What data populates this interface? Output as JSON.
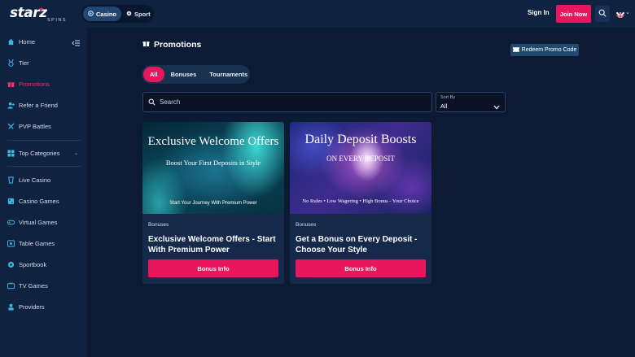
{
  "brand": {
    "name": "starz",
    "sub": "SPINS"
  },
  "header": {
    "modes": [
      {
        "label": "Casino",
        "active": true
      },
      {
        "label": "Sport",
        "active": false
      }
    ],
    "sign_in": "Sign In",
    "join_now": "Join Now",
    "icons": {
      "search": "search-icon",
      "flag": "uk-flag-icon"
    }
  },
  "sidebar": {
    "items": [
      {
        "label": "Home",
        "icon": "home-icon"
      },
      {
        "label": "Tier",
        "icon": "medal-icon"
      },
      {
        "label": "Promotions",
        "icon": "gift-icon",
        "active": true
      },
      {
        "label": "Refer a Friend",
        "icon": "user-plus-icon"
      },
      {
        "label": "PVP Battles",
        "icon": "swords-icon"
      },
      {
        "label": "Top Categories",
        "icon": "grid-icon"
      },
      {
        "label": "Live Casino",
        "icon": "chip-icon"
      },
      {
        "label": "Casino Games",
        "icon": "dice-icon"
      },
      {
        "label": "Virtual Games",
        "icon": "gamepad-icon"
      },
      {
        "label": "Table Games",
        "icon": "table-icon"
      },
      {
        "label": "Sportbook",
        "icon": "ball-icon"
      },
      {
        "label": "TV Games",
        "icon": "tv-icon"
      },
      {
        "label": "Providers",
        "icon": "providers-icon"
      }
    ]
  },
  "main": {
    "title": "Promotions",
    "redeem_label": "Redeem Promo Code",
    "tabs": [
      {
        "label": "All",
        "active": true
      },
      {
        "label": "Bonuses",
        "active": false
      },
      {
        "label": "Tournaments",
        "active": false
      }
    ],
    "search_placeholder": "Search",
    "sort": {
      "label": "Sort By",
      "value": "All"
    },
    "cards": [
      {
        "image_title": "Exclusive Welcome Offers",
        "image_subtitle": "Boost Your First Deposits in Style",
        "image_footer": "Start Your Journey With Premium Power",
        "badge": "Bonuses",
        "heading": "Exclusive Welcome Offers - Start With Premium Power",
        "button": "Bonus Info"
      },
      {
        "image_title": "Daily Deposit Boosts",
        "image_subtitle": "ON EVERY DEPOSIT",
        "image_footer": "No Rules • Low Wagering • High Bonus - Your Choice",
        "badge": "Bonuses",
        "heading": "Get a Bonus on Every Deposit - Choose Your Style",
        "button": "Bonus Info"
      }
    ]
  },
  "colors": {
    "accent": "#e8175d",
    "background": "#0c1a33",
    "panel": "#0f2240",
    "card": "#15294a",
    "sidebar_active": "#ff2c74"
  }
}
